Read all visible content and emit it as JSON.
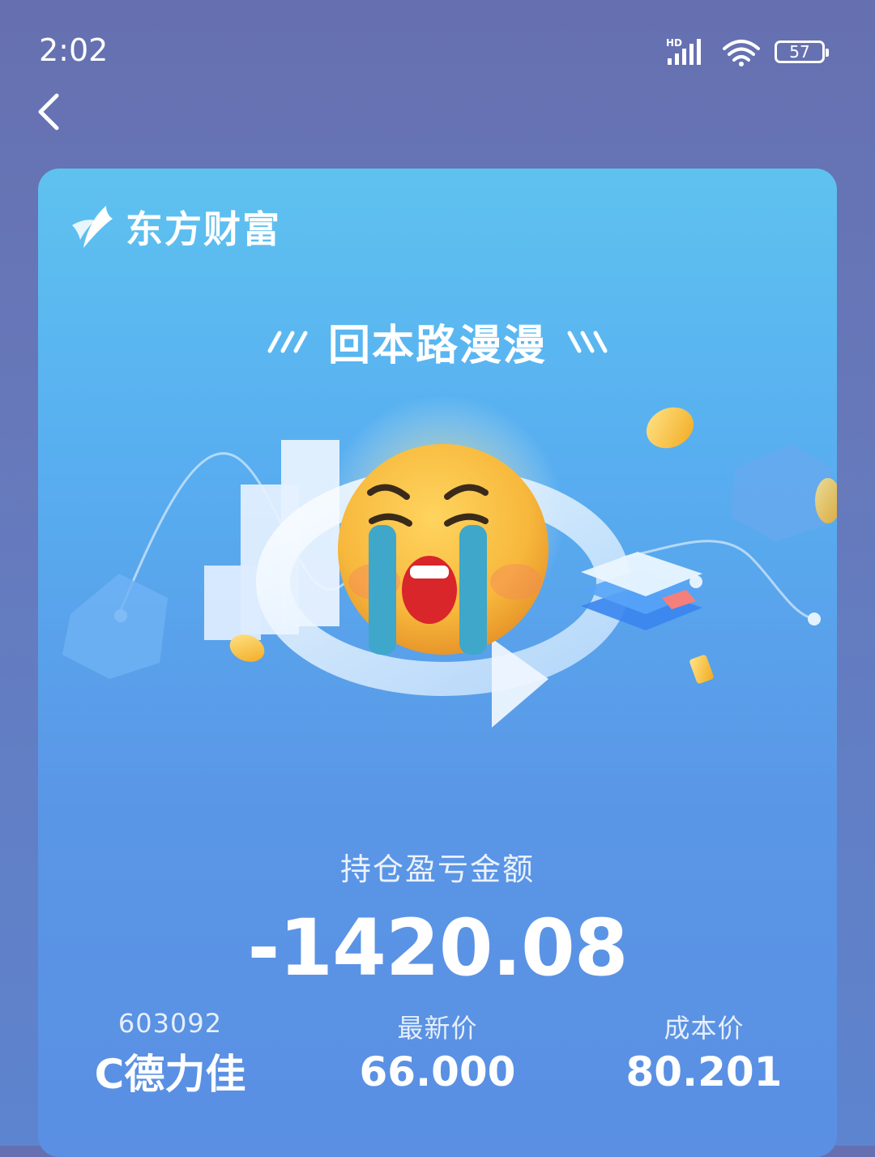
{
  "status_bar": {
    "time": "2:02",
    "network_badge": "HD",
    "battery": "57",
    "icons": [
      "signal-icon",
      "wifi-icon",
      "battery-icon"
    ]
  },
  "nav": {
    "back_icon": "chevron-left-icon"
  },
  "card": {
    "brand_name": "东方财富",
    "brand_icon": "eastmoney-logo",
    "headline": "回本路漫漫",
    "illustration": "crying-emoji-icon",
    "pnl_label": "持仓盈亏金额",
    "pnl_value": "-1420.08",
    "stock_code": "603092",
    "stock_name": "C德力佳",
    "latest_price_label": "最新价",
    "latest_price": "66.000",
    "cost_price_label": "成本价",
    "cost_price": "80.201"
  },
  "colors": {
    "background": "#6670b0",
    "card_top": "#5ec2ef",
    "card_bottom": "#5a8fe3",
    "emoji_face": "#f7b83c",
    "tears": "#3fa7c9"
  }
}
